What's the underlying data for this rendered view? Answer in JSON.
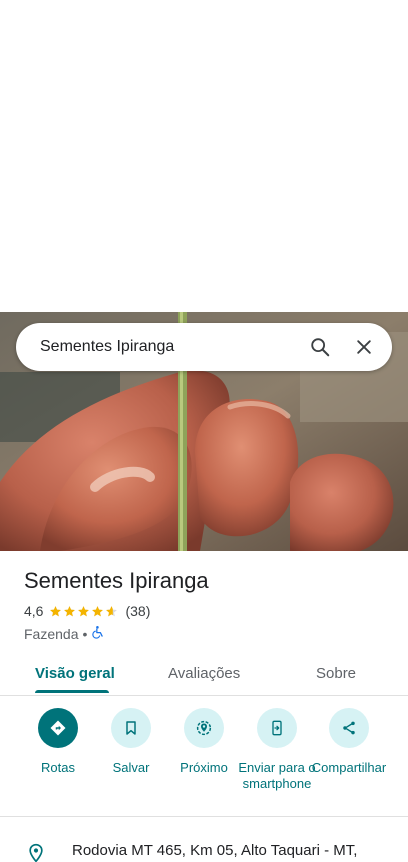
{
  "search": {
    "value": "Sementes Ipiranga"
  },
  "place": {
    "name": "Sementes Ipiranga",
    "rating": "4,6",
    "rating_stars": 4.6,
    "review_count": "(38)",
    "category": "Fazenda",
    "separator": "•"
  },
  "tabs": [
    {
      "label": "Visão geral",
      "active": true
    },
    {
      "label": "Avaliações",
      "active": false
    },
    {
      "label": "Sobre",
      "active": false
    }
  ],
  "actions": [
    {
      "label": "Rotas",
      "icon": "directions-icon"
    },
    {
      "label": "Salvar",
      "icon": "bookmark-icon"
    },
    {
      "label": "Próximo",
      "icon": "nearby-icon"
    },
    {
      "label": "Enviar para o smartphone",
      "icon": "send-to-phone-icon"
    },
    {
      "label": "Compartilhar",
      "icon": "share-icon"
    }
  ],
  "address": {
    "text": "Rodovia MT 465, Km 05, Alto Taquari - MT,"
  },
  "colors": {
    "accent": "#00737a",
    "accent_light": "#d6f2f4",
    "star": "#f4b400"
  }
}
